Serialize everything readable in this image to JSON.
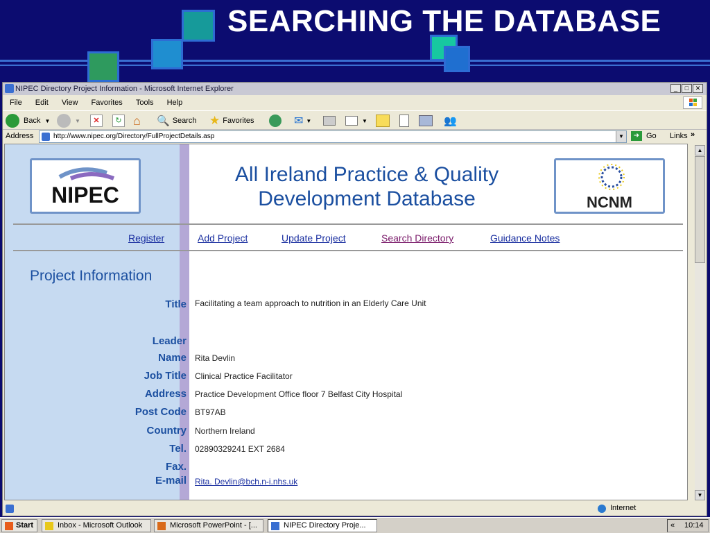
{
  "slide": {
    "title": "SEARCHING THE DATABASE"
  },
  "window": {
    "title": "NIPEC Directory Project Information - Microsoft Internet Explorer"
  },
  "menu": [
    "File",
    "Edit",
    "View",
    "Favorites",
    "Tools",
    "Help"
  ],
  "toolbar": {
    "back": "Back",
    "search": "Search",
    "favorites": "Favorites"
  },
  "address": {
    "label": "Address",
    "url": "http://www.nipec.org/Directory/FullProjectDetails.asp",
    "go": "Go",
    "links": "Links"
  },
  "page": {
    "logo_left": "NIPEC",
    "logo_right": "NCNM",
    "heading_line1": "All Ireland Practice & Quality",
    "heading_line2": "Development Database",
    "nav": [
      "Register",
      "Add Project",
      "Update Project",
      "Search Directory",
      "Guidance Notes"
    ],
    "section": "Project Information",
    "fields": [
      {
        "label": "Title",
        "value": "Facilitating a team approach to nutrition in an Elderly Care Unit"
      },
      {
        "label": "Leader",
        "value": ""
      },
      {
        "label": "Name",
        "value": "Rita Devlin"
      },
      {
        "label": "Job Title",
        "value": "Clinical Practice Facilitator"
      },
      {
        "label": "Address",
        "value": "Practice Development Office floor 7 Belfast City Hospital"
      },
      {
        "label": "Post Code",
        "value": "BT97AB"
      },
      {
        "label": "Country",
        "value": "Northern Ireland"
      },
      {
        "label": "Tel.",
        "value": "02890329241 EXT 2684"
      },
      {
        "label": "Fax.",
        "value": ""
      },
      {
        "label": "E-mail",
        "value": "Rita. Devlin@bch.n-i.nhs.uk"
      }
    ]
  },
  "status": {
    "zone": "Internet"
  },
  "taskbar": {
    "start": "Start",
    "tasks": [
      "Inbox - Microsoft Outlook",
      "Microsoft PowerPoint - [...",
      "NIPEC Directory Proje..."
    ],
    "clock": "10:14"
  },
  "colors": {
    "banner": "#0c0c70",
    "heading": "#1b4fa0",
    "left_column": "#c6daf1",
    "nav_link": "#1a2fa0",
    "visited_link": "#7a1a6a"
  }
}
